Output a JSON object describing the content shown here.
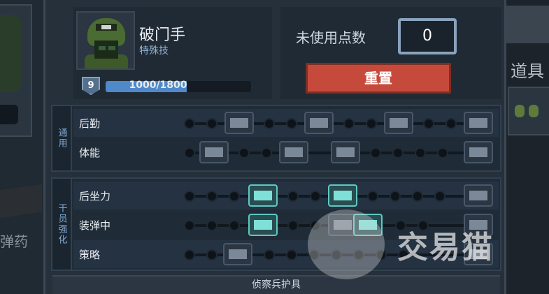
{
  "background": {
    "left_label": "弹药",
    "right_label": "道具"
  },
  "soldier": {
    "name": "破门手",
    "subtitle": "特殊技",
    "level": "9",
    "xp_text": "1000/1800",
    "xp_fraction": 0.556
  },
  "points": {
    "label": "未使用点数",
    "value": "0"
  },
  "reset_button": "重置",
  "sections": {
    "general": {
      "tab": "通用",
      "rows": [
        {
          "label": "后勤"
        },
        {
          "label": "体能"
        }
      ]
    },
    "cadre": {
      "tab": "干员强化",
      "rows": [
        {
          "label": "后坐力"
        },
        {
          "label": "装弹中"
        },
        {
          "label": "策略"
        }
      ]
    }
  },
  "footer": "侦察兵护具",
  "watermark": "交易猫",
  "colors": {
    "accent": "#4f89c9",
    "reset": "#c64a3c",
    "lit_node": "#5fc8c4"
  }
}
